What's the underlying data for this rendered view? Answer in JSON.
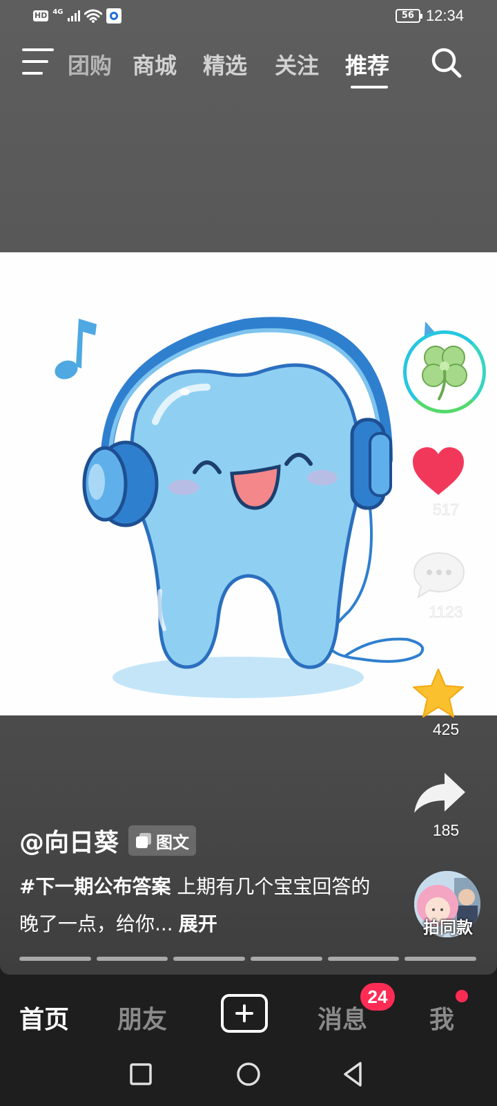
{
  "status_bar": {
    "hd": "HD",
    "network": "4G",
    "battery": "56",
    "time": "12:34"
  },
  "top_nav": {
    "tabs": [
      {
        "label": "团购",
        "state": "partially-hidden"
      },
      {
        "label": "商城"
      },
      {
        "label": "精选"
      },
      {
        "label": "关注"
      },
      {
        "label": "推荐",
        "active": true
      }
    ],
    "menu_icon": "menu-icon",
    "search_icon": "search-icon"
  },
  "post": {
    "image_subject": "tooth-with-headphones-illustration",
    "author": "@向日葵",
    "type_badge": "图文",
    "caption_tag": "#下一期公布答案",
    "caption_text": " 上期有几个宝宝回答的晚了一点，给你...",
    "expand_label": "展开",
    "page_count": 6
  },
  "actions": {
    "like_count": "517",
    "comment_count": "1123",
    "favorite_count": "425",
    "share_count": "185",
    "remix_label": "拍同款"
  },
  "bottom_nav": {
    "items": [
      "首页",
      "朋友",
      "消息",
      "我"
    ],
    "active": "首页",
    "message_badge": "24"
  },
  "colors": {
    "accent_red": "#fe2c55",
    "like_red": "#f2385a",
    "favorite_yellow": "#fbc02d",
    "tooth_blue": "#8fd0f2",
    "headphone_blue": "#2f7fcf"
  }
}
